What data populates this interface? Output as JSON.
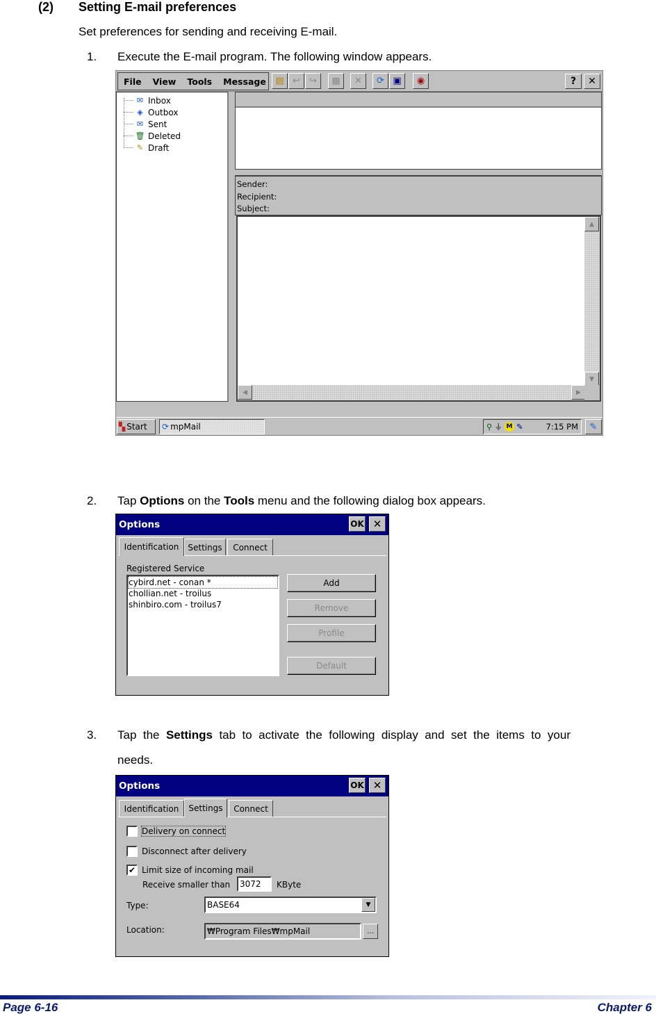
{
  "section": {
    "number": "(2)",
    "title": "Setting E-mail preferences",
    "intro": "Set preferences for sending and receiving E-mail."
  },
  "steps": [
    {
      "num": "1.",
      "text": "Execute the E-mail program. The following window appears."
    },
    {
      "num": "2.",
      "pre": "Tap ",
      "b1": "Options",
      "mid": " on the ",
      "b2": "Tools",
      "post": " menu and the following dialog box appears."
    },
    {
      "num": "3.",
      "pre": "Tap  the  ",
      "b1": "Settings",
      "post": "  tab  to  activate  the  following  display  and  set  the  items  to  your",
      "line2": "needs."
    }
  ],
  "mail_window": {
    "menu": [
      "File",
      "View",
      "Tools",
      "Message"
    ],
    "toolbar_icons": [
      "new-message-icon",
      "reply-icon",
      "reply-all-icon",
      "print-icon",
      "delete-icon",
      "send-receive-icon",
      "connect-icon",
      "address-book-icon"
    ],
    "help_label": "?",
    "close_label": "✕",
    "folders": [
      "Inbox",
      "Outbox",
      "Sent",
      "Deleted",
      "Draft"
    ],
    "header_fields": [
      "Sender:",
      "Recipient:",
      "Subject:"
    ],
    "taskbar": {
      "start_label": "Start",
      "task_label": "mpMail",
      "clock": "7:15 PM"
    }
  },
  "options_identification": {
    "title": "Options",
    "ok_label": "OK",
    "close_label": "✕",
    "tabs": [
      "Identification",
      "Settings",
      "Connect"
    ],
    "active_tab": "Identification",
    "registered_service_label": "Registered Service",
    "services": [
      "cybird.net - conan *",
      "chollian.net - troilus",
      "shinbiro.com - troilus7"
    ],
    "buttons": {
      "add": "Add",
      "remove": "Remove",
      "profile": "Profile",
      "default": "Default"
    }
  },
  "options_settings": {
    "title": "Options",
    "ok_label": "OK",
    "close_label": "✕",
    "tabs": [
      "Identification",
      "Settings",
      "Connect"
    ],
    "active_tab": "Settings",
    "delivery_on_connect": {
      "label": "Delivery on connect",
      "checked": false
    },
    "disconnect_after_delivery": {
      "label": "Disconnect after delivery",
      "checked": false
    },
    "limit_size": {
      "label": "Limit size of incoming mail",
      "checked": true
    },
    "receive_smaller_label": "Receive smaller than",
    "receive_smaller_value": "3072",
    "unit_label": "KByte",
    "type_label": "Type:",
    "type_value": "BASE64",
    "location_label": "Location:",
    "location_value": "₩Program Files₩mpMail",
    "browse_label": "..."
  },
  "footer": {
    "page": "Page 6-16",
    "chapter": "Chapter 6"
  }
}
